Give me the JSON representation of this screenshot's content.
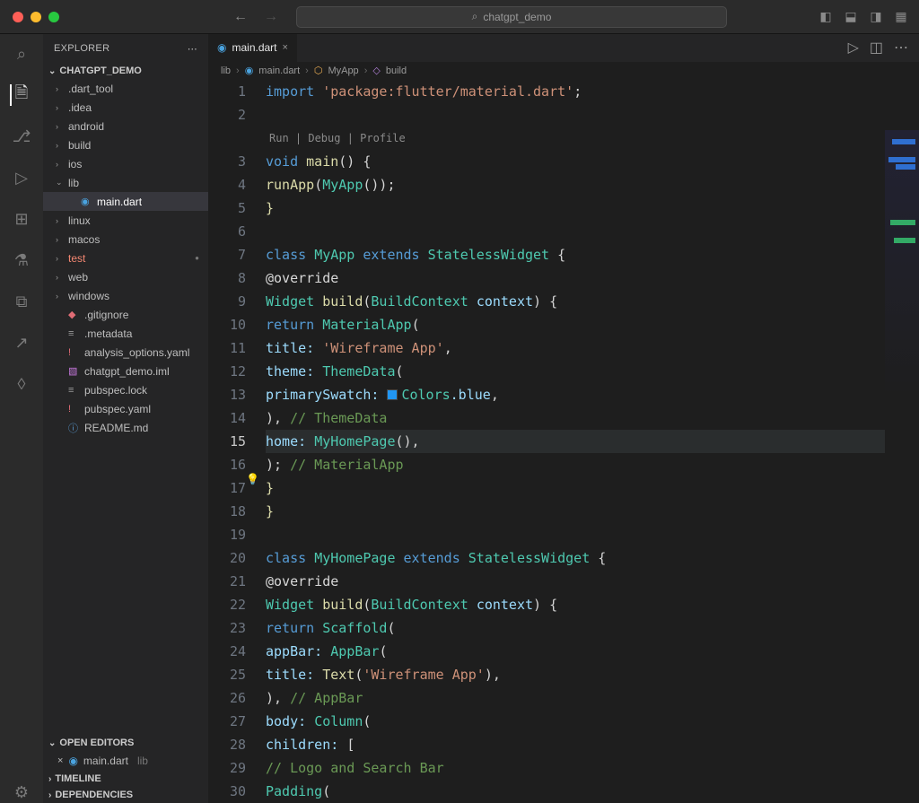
{
  "title": "chatgpt_demo",
  "explorer": {
    "label": "EXPLORER",
    "project": "CHATGPT_DEMO",
    "tree": [
      {
        "label": ".dart_tool",
        "kind": "folder"
      },
      {
        "label": ".idea",
        "kind": "folder"
      },
      {
        "label": "android",
        "kind": "folder"
      },
      {
        "label": "build",
        "kind": "folder"
      },
      {
        "label": "ios",
        "kind": "folder"
      },
      {
        "label": "lib",
        "kind": "folder",
        "open": true,
        "children": [
          {
            "label": "main.dart",
            "kind": "dart",
            "selected": true
          }
        ]
      },
      {
        "label": "linux",
        "kind": "folder"
      },
      {
        "label": "macos",
        "kind": "folder"
      },
      {
        "label": "test",
        "kind": "folder",
        "red": true,
        "modified": true
      },
      {
        "label": "web",
        "kind": "folder"
      },
      {
        "label": "windows",
        "kind": "folder"
      },
      {
        "label": ".gitignore",
        "kind": "git"
      },
      {
        "label": ".metadata",
        "kind": "file"
      },
      {
        "label": "analysis_options.yaml",
        "kind": "yaml",
        "warn": true
      },
      {
        "label": "chatgpt_demo.iml",
        "kind": "iml"
      },
      {
        "label": "pubspec.lock",
        "kind": "file"
      },
      {
        "label": "pubspec.yaml",
        "kind": "yaml",
        "warn": true
      },
      {
        "label": "README.md",
        "kind": "md"
      }
    ],
    "sections": {
      "open_editors": "OPEN EDITORS",
      "timeline": "TIMELINE",
      "dependencies": "DEPENDENCIES"
    },
    "open_editor": {
      "file": "main.dart",
      "dir": "lib"
    }
  },
  "tab": {
    "label": "main.dart"
  },
  "breadcrumbs": [
    "lib",
    "main.dart",
    "MyApp",
    "build"
  ],
  "codelens": "Run | Debug | Profile",
  "code": {
    "lines": [
      1,
      2,
      3,
      4,
      5,
      6,
      7,
      8,
      9,
      10,
      11,
      12,
      13,
      14,
      15,
      16,
      17,
      18,
      19,
      20,
      21,
      22,
      23,
      24,
      25,
      26,
      27,
      28,
      29,
      30
    ],
    "active_line": 15,
    "content": {
      "l1": {
        "import": "import ",
        "str": "'package:flutter/material.dart'",
        "semi": ";"
      },
      "l3": {
        "void": "void ",
        "main": "main",
        "paren": "() {",
        "open": ""
      },
      "l4": {
        "indent": "  ",
        "run": "runApp",
        "op": "(",
        "cls": "MyApp",
        "tail": "());"
      },
      "l5": {
        "close": "}"
      },
      "l7": {
        "class": "class ",
        "name": "MyApp",
        "ext": " extends ",
        "base": "StatelessWidget",
        "open": " {"
      },
      "l8": {
        "indent": "  ",
        "anno": "@override"
      },
      "l9": {
        "indent": "  ",
        "type": "Widget ",
        "fn": "build",
        "op": "(",
        "argt": "BuildContext ",
        "arg": "context",
        "close": ") {"
      },
      "l10": {
        "indent": "    ",
        "ret": "return ",
        "cls": "MaterialApp",
        "op": "("
      },
      "l11": {
        "indent": "      ",
        "key": "title: ",
        "str": "'Wireframe App'",
        "comma": ","
      },
      "l12": {
        "indent": "      ",
        "key": "theme: ",
        "cls": "ThemeData",
        "op": "("
      },
      "l13": {
        "indent": "        ",
        "key": "primarySwatch: ",
        "color": "Colors",
        "dot": ".blue",
        "comma": ","
      },
      "l14": {
        "indent": "      ",
        "close": "),",
        "cmt": " // ThemeData"
      },
      "l15": {
        "indent": "      ",
        "key": "home: ",
        "cls": "MyHomePage",
        "tail": "(),"
      },
      "l16": {
        "indent": "    ",
        "close": ");",
        "cmt": " // MaterialApp"
      },
      "l17": {
        "indent": "  ",
        "close": "}"
      },
      "l18": {
        "close": "}"
      },
      "l20": {
        "class": "class ",
        "name": "MyHomePage",
        "ext": " extends ",
        "base": "StatelessWidget",
        "open": " {"
      },
      "l21": {
        "indent": "  ",
        "anno": "@override"
      },
      "l22": {
        "indent": "  ",
        "type": "Widget ",
        "fn": "build",
        "op": "(",
        "argt": "BuildContext ",
        "arg": "context",
        "close": ") {"
      },
      "l23": {
        "indent": "    ",
        "ret": "return ",
        "cls": "Scaffold",
        "op": "("
      },
      "l24": {
        "indent": "      ",
        "key": "appBar: ",
        "cls": "AppBar",
        "op": "("
      },
      "l25": {
        "indent": "        ",
        "key": "title: ",
        "fn": "Text",
        "op": "(",
        "str": "'Wireframe App'",
        "close": "),"
      },
      "l26": {
        "indent": "      ",
        "close": "),",
        "cmt": " // AppBar"
      },
      "l27": {
        "indent": "      ",
        "key": "body: ",
        "cls": "Column",
        "op": "("
      },
      "l28": {
        "indent": "        ",
        "key": "children: ",
        "br": "["
      },
      "l29": {
        "indent": "          ",
        "cmt": "// Logo and Search Bar"
      },
      "l30": {
        "indent": "          ",
        "cls": "Padding",
        "op": "("
      }
    }
  }
}
